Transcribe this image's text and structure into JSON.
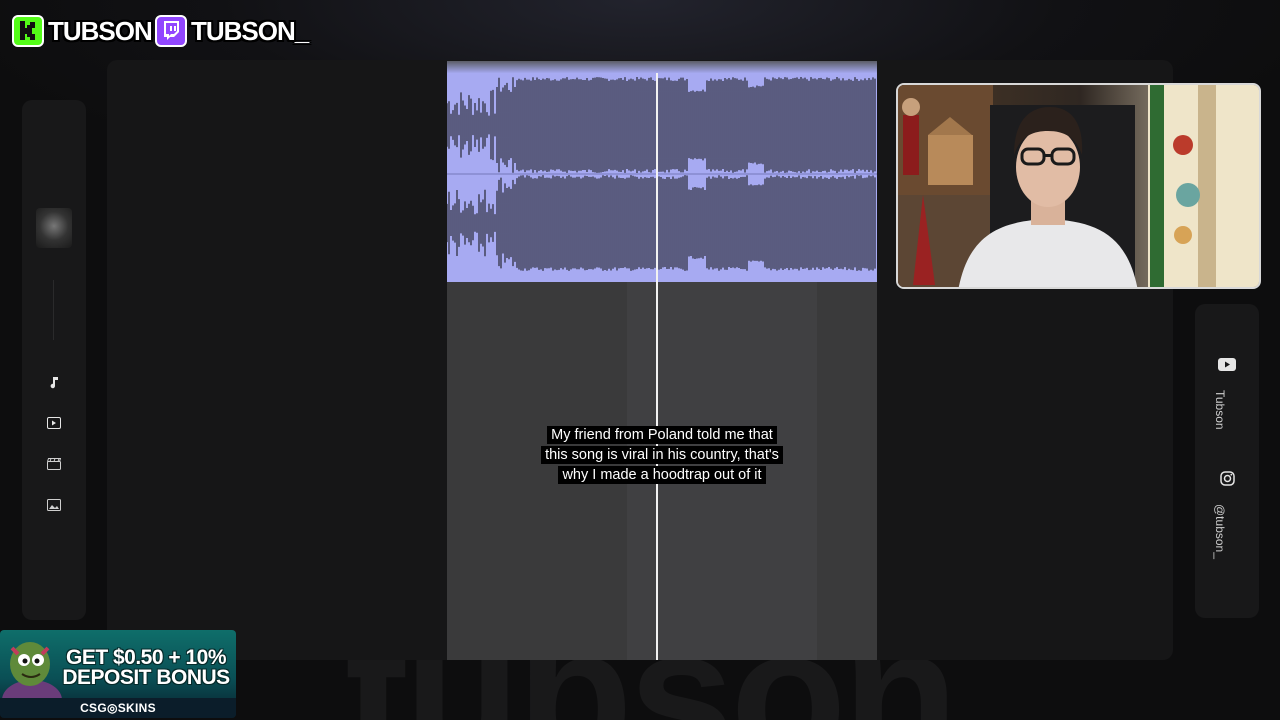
{
  "channels": {
    "kick": {
      "icon": "kick-logo-icon",
      "name": "TUBSON",
      "color": "#53fc18"
    },
    "twitch": {
      "icon": "twitch-logo-icon",
      "name": "TUBSON_",
      "color": "#9146ff"
    }
  },
  "watermark": "tubson",
  "left_sidebar": {
    "items": [
      {
        "icon": "music-note-icon"
      },
      {
        "icon": "video-play-icon"
      },
      {
        "icon": "clapperboard-icon"
      },
      {
        "icon": "image-icon"
      }
    ]
  },
  "video": {
    "caption": "My friend from Poland told me that this song is viral in his country, that's why I made a hoodtrap out of it",
    "waveform_color": "#a7aaf2"
  },
  "social": {
    "youtube": {
      "icon": "youtube-icon",
      "handle": "Tubson"
    },
    "instagram": {
      "icon": "instagram-icon",
      "handle": "@tubson_"
    }
  },
  "ad": {
    "line1": "GET $0.50 + 10%",
    "line2": "DEPOSIT BONUS",
    "brand": "CSG◎SKINS"
  }
}
